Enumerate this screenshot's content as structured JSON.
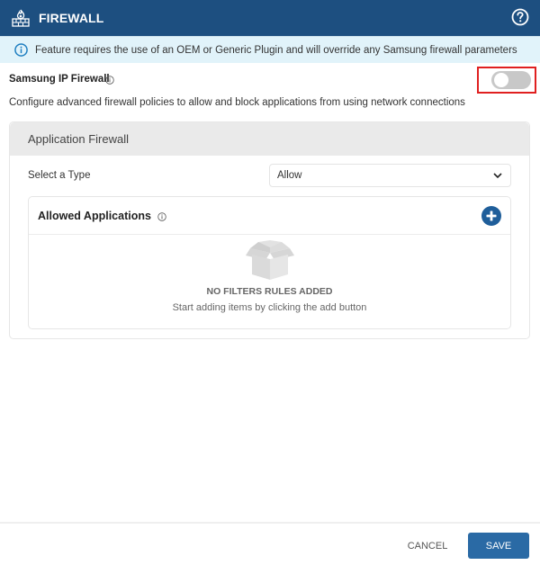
{
  "header": {
    "title": "FIREWALL",
    "icon": "firewall-icon",
    "help_icon": "help-circle-icon"
  },
  "banner": {
    "icon": "info-icon",
    "text": "Feature requires the use of an OEM or Generic Plugin and will override any Samsung firewall parameters"
  },
  "samsung_ip_firewall": {
    "label": "Samsung IP Firewall",
    "info_icon": "info-icon",
    "enabled": false,
    "description": "Configure advanced firewall policies to allow and block applications from using network connections"
  },
  "application_firewall": {
    "title": "Application Firewall",
    "type_label": "Select a Type",
    "type_value": "Allow",
    "list": {
      "title": "Allowed Applications",
      "info_icon": "info-icon",
      "add_icon": "plus-circle-icon",
      "empty_icon": "empty-box-icon",
      "empty_title": "NO FILTERS RULES ADDED",
      "empty_subtitle": "Start adding items by clicking the add button"
    }
  },
  "footer": {
    "cancel_label": "CANCEL",
    "save_label": "SAVE"
  },
  "colors": {
    "header_bg": "#1d4f80",
    "banner_bg": "#e1f3fa",
    "accent": "#2a6aa5",
    "highlight_frame": "#e02020"
  }
}
